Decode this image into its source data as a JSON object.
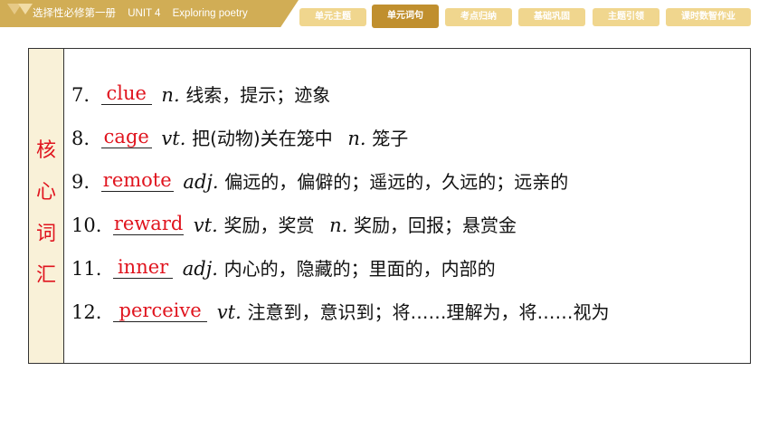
{
  "header": {
    "book": "选择性必修第一册",
    "unit": "UNIT 4",
    "topic": "Exploring poetry"
  },
  "nav": [
    {
      "label": "单元主题",
      "active": false
    },
    {
      "label": "单元词句",
      "active": true
    },
    {
      "label": "考点归纳",
      "active": false
    },
    {
      "label": "基础巩固",
      "active": false
    },
    {
      "label": "主题引领",
      "active": false
    },
    {
      "label": "课时数智作业",
      "active": false
    }
  ],
  "colors": {
    "header_gold": "#d1ad55",
    "nav_light": "#f0d68e",
    "nav_active": "#c08f2e",
    "answer_red": "#e0141e",
    "side_bg": "#f9f1d8"
  },
  "side_label": [
    "核",
    "心",
    "词",
    "汇"
  ],
  "vocab": [
    {
      "num": "7.",
      "answer": "clue",
      "pos1": "n.",
      "def1": "线索，提示；迹象",
      "pos2": "",
      "def2": ""
    },
    {
      "num": "8.",
      "answer": "cage",
      "pos1": "vt.",
      "def1": "把(动物)关在笼中",
      "pos2": "n.",
      "def2": "笼子"
    },
    {
      "num": "9.",
      "answer": "remote",
      "pos1": "adj.",
      "def1": "偏远的，偏僻的；遥远的，久远的；远亲的",
      "pos2": "",
      "def2": ""
    },
    {
      "num": "10.",
      "answer": "reward",
      "pos1": "vt.",
      "def1": "奖励，奖赏",
      "pos2": "n.",
      "def2": "奖励，回报；悬赏金"
    },
    {
      "num": "11.",
      "answer": "inner",
      "pos1": "adj.",
      "def1": "内心的，隐藏的；里面的，内部的",
      "pos2": "",
      "def2": ""
    },
    {
      "num": "12.",
      "answer": "perceive",
      "pos1": "vt.",
      "def1": "注意到，意识到；将……理解为，将……视为",
      "pos2": "",
      "def2": ""
    }
  ]
}
